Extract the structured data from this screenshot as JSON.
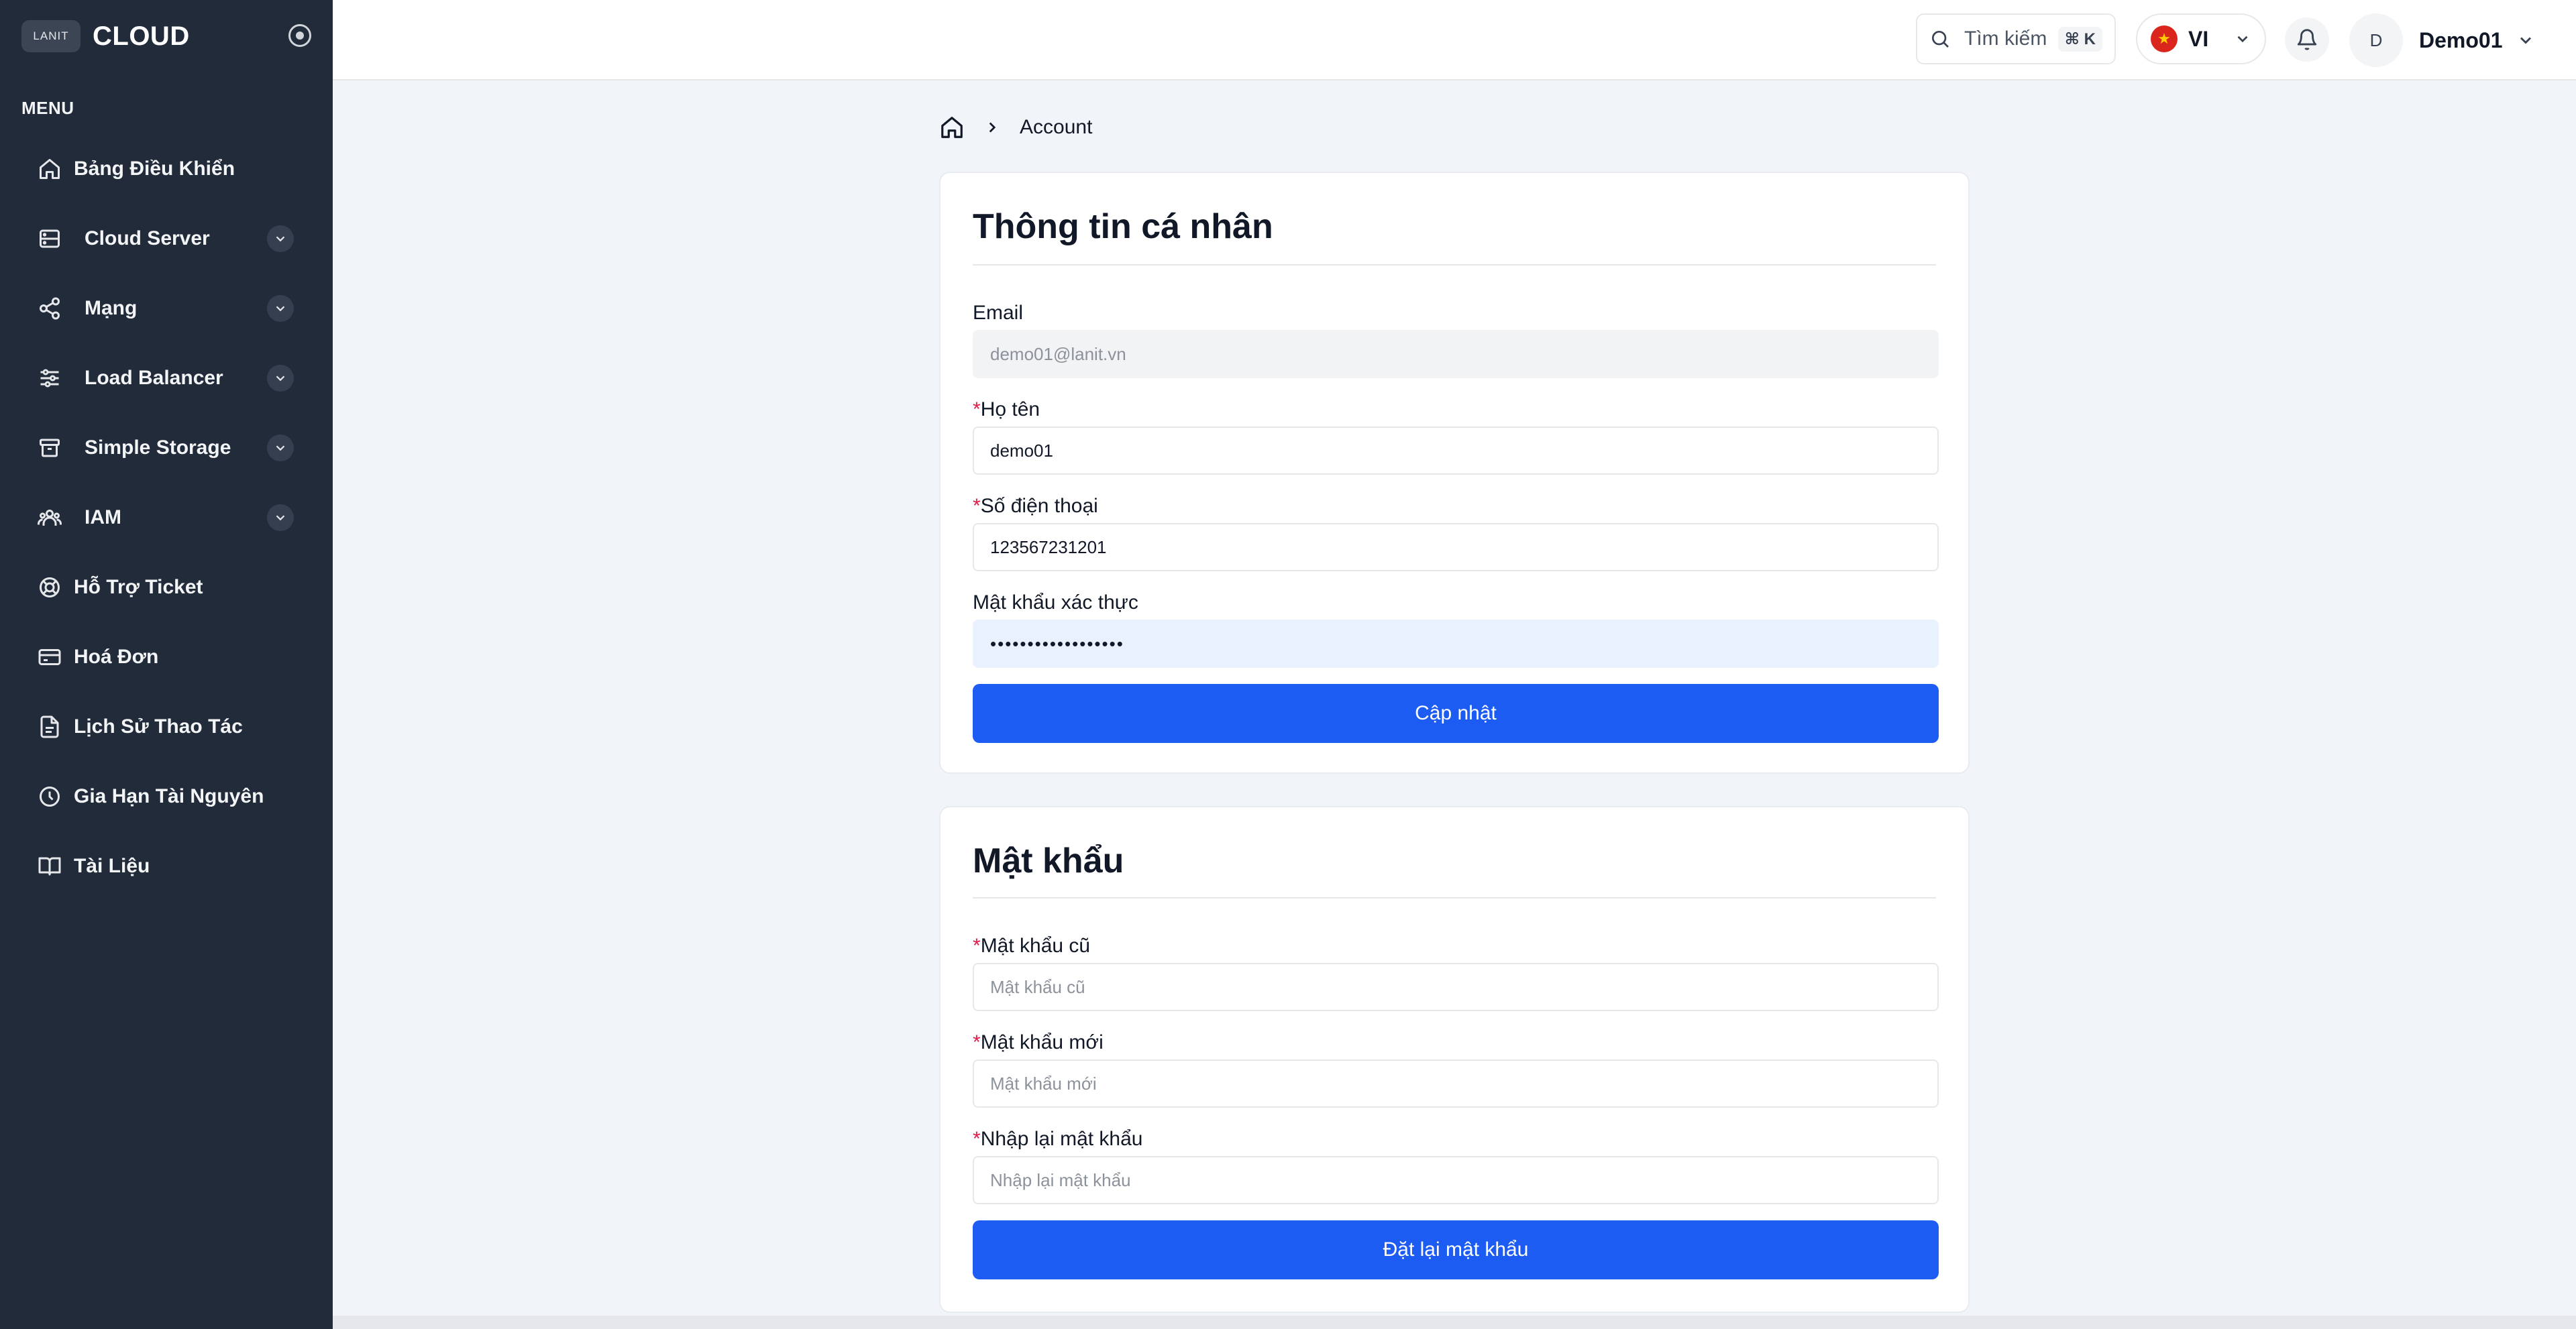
{
  "sidebar": {
    "brand_logo": "LANIT",
    "brand_name": "CLOUD",
    "menu_label": "MENU",
    "items": [
      {
        "label": "Bảng Điều Khiển"
      },
      {
        "label": "Cloud Server"
      },
      {
        "label": "Mạng"
      },
      {
        "label": "Load Balancer"
      },
      {
        "label": "Simple Storage"
      },
      {
        "label": "IAM"
      },
      {
        "label": "Hỗ Trợ Ticket"
      },
      {
        "label": "Hoá Đơn"
      },
      {
        "label": "Lịch Sử Thao Tác"
      },
      {
        "label": "Gia Hạn Tài Nguyên"
      },
      {
        "label": "Tài Liệu"
      }
    ]
  },
  "topbar": {
    "search_label": "Tìm kiếm",
    "search_shortcut": "⌘ K",
    "language": "VI",
    "avatar_initial": "D",
    "user_name": "Demo01"
  },
  "breadcrumb": {
    "current": "Account"
  },
  "profile": {
    "title": "Thông tin cá nhân",
    "email_label": "Email",
    "email_value": "demo01@lanit.vn",
    "name_label": "Họ tên",
    "name_value": "demo01",
    "phone_label": "Số điện thoại",
    "phone_value": "123567231201",
    "verify_password_label": "Mật khẩu xác thực",
    "verify_password_value": "••••••••••••••••••",
    "submit_label": "Cập nhật"
  },
  "password": {
    "title": "Mật khẩu",
    "old_label": "Mật khẩu cũ",
    "old_placeholder": "Mật khẩu cũ",
    "new_label": "Mật khẩu mới",
    "new_placeholder": "Mật khẩu mới",
    "confirm_label": "Nhập lại mật khẩu",
    "confirm_placeholder": "Nhập lại mật khẩu",
    "submit_label": "Đặt lại mật khẩu"
  },
  "colors": {
    "sidebar_bg": "#222b3a",
    "primary": "#1d5cf2",
    "required": "#e11d48",
    "page_bg": "#f1f4f9"
  }
}
